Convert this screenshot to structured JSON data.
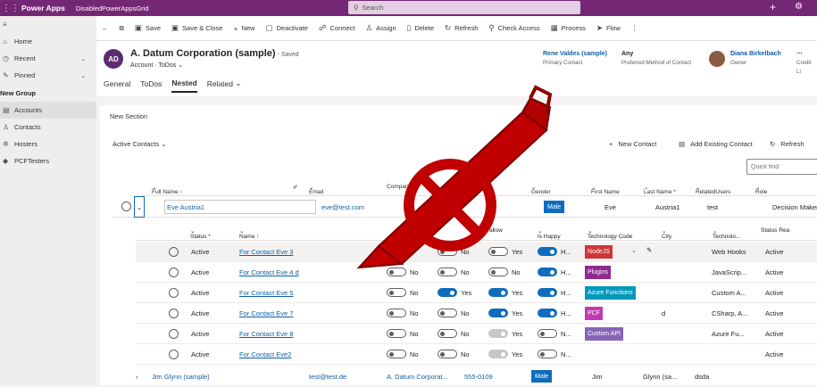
{
  "topbar": {
    "brand": "Power Apps",
    "environment": "DisabledPowerAppsGrid",
    "search_placeholder": "Search"
  },
  "sidebar": {
    "items": [
      {
        "label": "Home",
        "icon": "home-icon",
        "glyph": "⌂"
      },
      {
        "label": "Recent",
        "icon": "clock-icon",
        "glyph": "◷"
      },
      {
        "label": "Pinned",
        "icon": "pin-icon",
        "glyph": "✎"
      }
    ],
    "group": "New Group",
    "group_items": [
      {
        "label": "Accounts",
        "icon": "building-icon",
        "glyph": "▤"
      },
      {
        "label": "Contacts",
        "icon": "person-icon",
        "glyph": "♙"
      },
      {
        "label": "Hosters",
        "icon": "settings-icon",
        "glyph": "✲"
      },
      {
        "label": "PCFTesters",
        "icon": "diamond-icon",
        "glyph": "◆"
      }
    ]
  },
  "commands": [
    {
      "label": "Save",
      "glyph": "▣"
    },
    {
      "label": "Save & Close",
      "glyph": "▣"
    },
    {
      "label": "New",
      "glyph": "+"
    },
    {
      "label": "Deactivate",
      "glyph": "▢"
    },
    {
      "label": "Connect",
      "glyph": "☍"
    },
    {
      "label": "Assign",
      "glyph": "♙"
    },
    {
      "label": "Delete",
      "glyph": "▯"
    },
    {
      "label": "Refresh",
      "glyph": "↻"
    },
    {
      "label": "Check Access",
      "glyph": "⚲"
    },
    {
      "label": "Process",
      "glyph": "▦"
    },
    {
      "label": "Flow",
      "glyph": "➤"
    }
  ],
  "record": {
    "initials": "AD",
    "title": "A. Datum Corporation (sample)",
    "saved": "- Saved",
    "entity": "Account",
    "form": "ToDos",
    "primary_contact": "Rene Valdes (sample)",
    "primary_contact_label": "Primary Contact",
    "preferred_method": "Any",
    "preferred_method_label": "Preferred Method of Contact",
    "owner": "Diana Birkelbach",
    "owner_label": "Owner",
    "credit_label": "Credit Li"
  },
  "tabs": [
    "General",
    "ToDos",
    "Nested",
    "Related"
  ],
  "section": {
    "title": "New Section",
    "subgrid_title": "Active Contacts",
    "new_contact": "New Contact",
    "add_existing": "Add Existing Contact",
    "refresh": "Refresh",
    "quick_find": "Quick find"
  },
  "columns": {
    "full_name": "Full Name ↑",
    "email": "Email",
    "company": "Compan",
    "gender": "Gender",
    "first_name": "First Name",
    "last_name": "Last Name *",
    "related_users": "RelatedUsers",
    "role": "Role"
  },
  "parent_rows": [
    {
      "full_name": "Eve Austria1",
      "email": "eve@test.com",
      "gender": "Male",
      "first_name": "Eve",
      "last_name": "Austria1",
      "related": "test",
      "role": "Decision Maker"
    },
    {
      "full_name": "Jim Glynn (sample)",
      "email": "test@test.de",
      "company": "A. Datum Corporat...",
      "phone": "555-0109",
      "gender": "Male",
      "first_name": "Jim",
      "last_name": "Glynn (sa...",
      "related": "dsda"
    }
  ],
  "nested_columns": {
    "status": "Status *",
    "name": "Name ↑",
    "allow": "allow",
    "happy": "Is Happy",
    "tech_code": "Technology Code",
    "city": "City",
    "technology": "Technolo...",
    "status_reason": "Status Rea"
  },
  "nested_rows": [
    {
      "status": "Active",
      "name": "For Contact Eve 3",
      "t1": "off",
      "l1": "",
      "t2": "off",
      "l2": "No",
      "t3": "off",
      "l3": "Yes",
      "t4": "on",
      "l4": "H...",
      "tech": "NodeJS",
      "tech_color": "#d13438",
      "city": "",
      "techno": "Web Hooks",
      "sr": "Active"
    },
    {
      "status": "Active",
      "name": "For Contact Eve 4 d",
      "t1": "off",
      "l1": "No",
      "t2": "off",
      "l2": "No",
      "t3": "off",
      "l3": "No",
      "t4": "on",
      "l4": "H...",
      "tech": "Plugins",
      "tech_color": "#8e2a8e",
      "city": "",
      "techno": "JavaScrip...",
      "sr": "Active"
    },
    {
      "status": "Active",
      "name": "For Contact Eve 5",
      "t1": "off",
      "l1": "No",
      "t2": "on",
      "l2": "Yes",
      "t3": "on",
      "l3": "Yes",
      "t4": "on",
      "l4": "H...",
      "tech": "Azure Functions",
      "tech_color": "#0099bc",
      "city": "",
      "techno": "Custom A...",
      "sr": "Active"
    },
    {
      "status": "Active",
      "name": "For Contact Eve 7",
      "t1": "off",
      "l1": "No",
      "t2": "off",
      "l2": "No",
      "t3": "on",
      "l3": "Yes",
      "t4": "on",
      "l4": "H...",
      "tech": "PCF",
      "tech_color": "#c239b3",
      "city": "d",
      "techno": "CSharp, A...",
      "sr": "Active"
    },
    {
      "status": "Active",
      "name": "For Contact Eve 8",
      "t1": "off",
      "l1": "No",
      "t2": "off",
      "l2": "No",
      "t3": "dis",
      "l3": "Yes",
      "t4": "off",
      "l4": "N...",
      "tech": "Custom API",
      "tech_color": "#8764b8",
      "city": "",
      "techno": "Azure Fu...",
      "sr": "Active"
    },
    {
      "status": "Active",
      "name": "For Contact Eve2",
      "t1": "off",
      "l1": "No",
      "t2": "off",
      "l2": "No",
      "t3": "dis",
      "l3": "Yes",
      "t4": "off",
      "l4": "N...",
      "tech": "",
      "tech_color": "",
      "city": "",
      "techno": "",
      "sr": "Active"
    }
  ],
  "overlay_icon": "no-edit-pen-icon"
}
